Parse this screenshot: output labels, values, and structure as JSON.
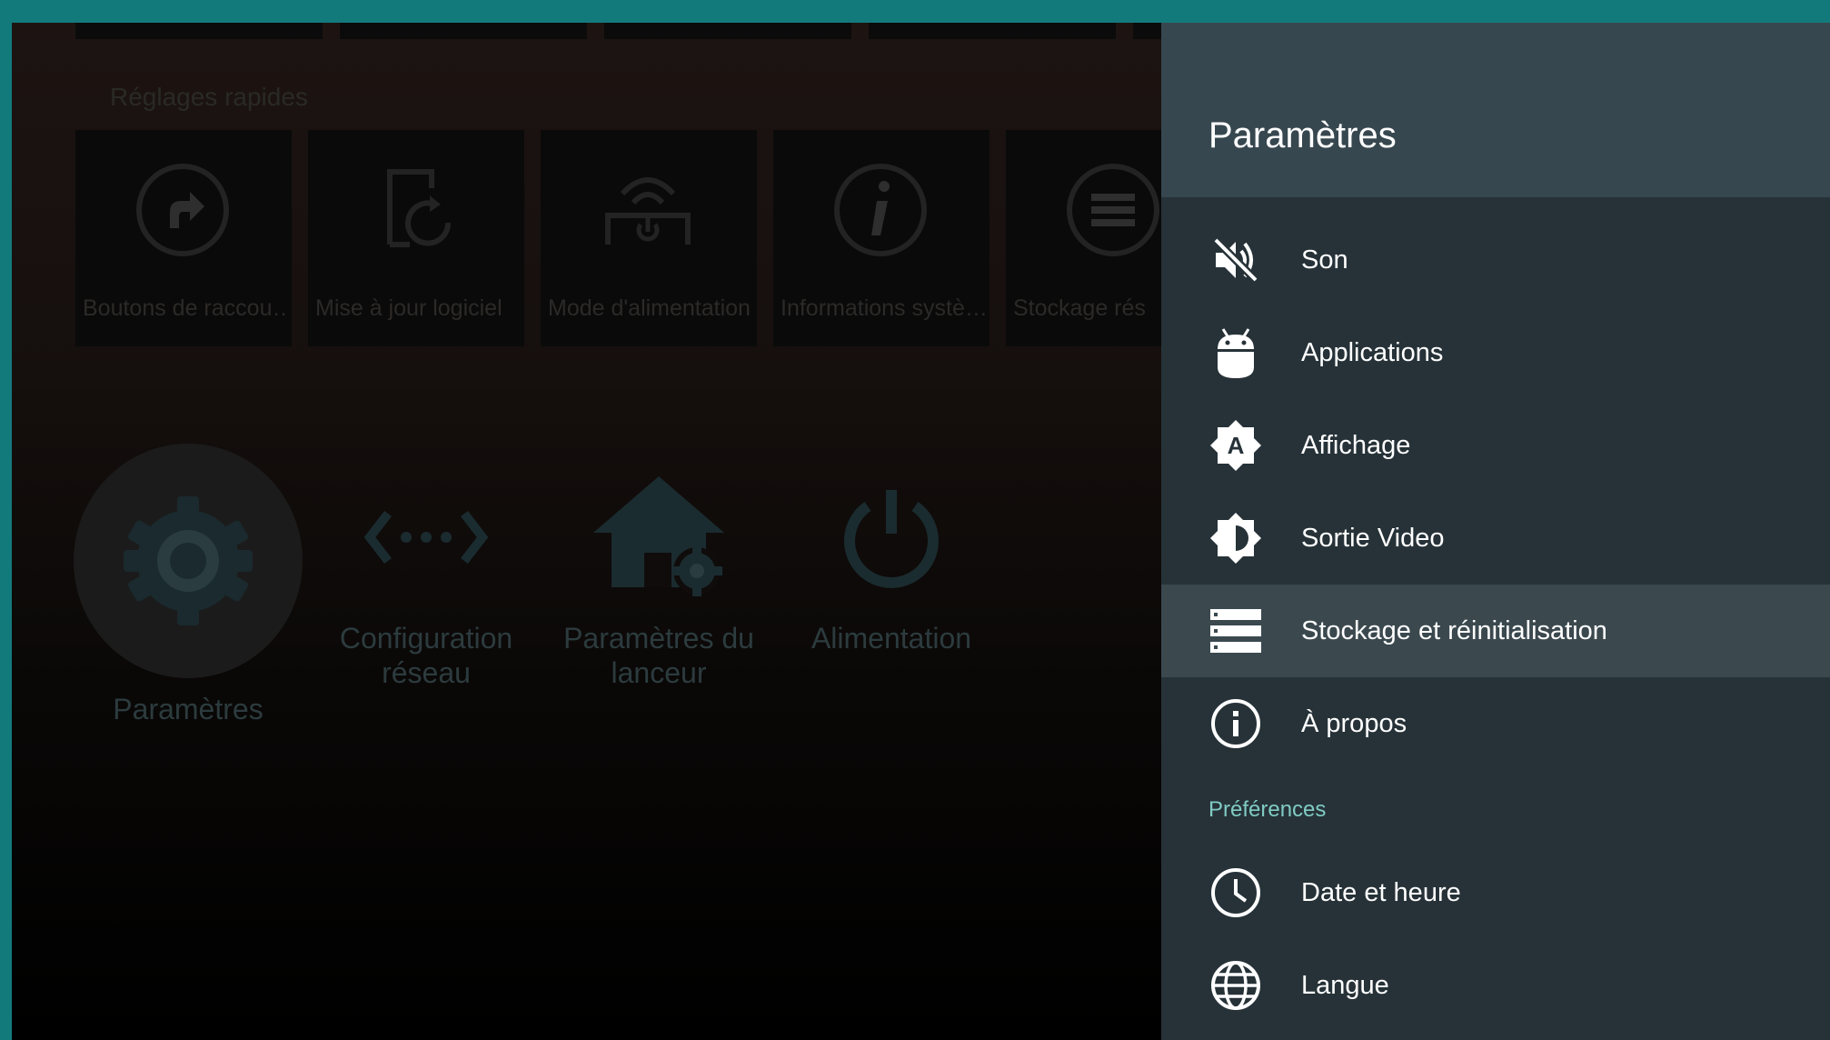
{
  "launcher": {
    "quick_settings_heading": "Réglages rapides",
    "quick_settings": [
      {
        "label": "Boutons de raccou…",
        "icon": "shortcut-icon"
      },
      {
        "label": "Mise à jour logiciel",
        "icon": "software-update-icon"
      },
      {
        "label": "Mode d'alimentation",
        "icon": "power-mode-icon"
      },
      {
        "label": "Informations systè…",
        "icon": "info-icon"
      },
      {
        "label": "Stockage rés",
        "icon": "storage-icon"
      }
    ],
    "apps": [
      {
        "label": "Paramètres",
        "icon": "gear-icon"
      },
      {
        "label": "Configuration réseau",
        "icon": "network-icon"
      },
      {
        "label": "Paramètres du lanceur",
        "icon": "home-gear-icon"
      },
      {
        "label": "Alimentation",
        "icon": "power-icon"
      }
    ]
  },
  "panel": {
    "title": "Paramètres",
    "items": [
      {
        "label": "Son",
        "icon": "sound-mute-icon"
      },
      {
        "label": "Applications",
        "icon": "android-icon"
      },
      {
        "label": "Affichage",
        "icon": "brightness-auto-icon"
      },
      {
        "label": "Sortie Video",
        "icon": "brightness-icon"
      },
      {
        "label": "Stockage et réinitialisation",
        "icon": "storage-icon",
        "selected": true
      },
      {
        "label": "À propos",
        "icon": "info-icon"
      }
    ],
    "section_label": "Préférences",
    "preference_items": [
      {
        "label": "Date et heure",
        "icon": "clock-icon"
      },
      {
        "label": "Langue",
        "icon": "globe-icon"
      }
    ]
  },
  "colors": {
    "border": "#137a7c",
    "panel_bg": "#263238",
    "panel_header_bg": "#37474f",
    "selected_bg": "#3b494f",
    "section_accent": "#80cbc4"
  }
}
